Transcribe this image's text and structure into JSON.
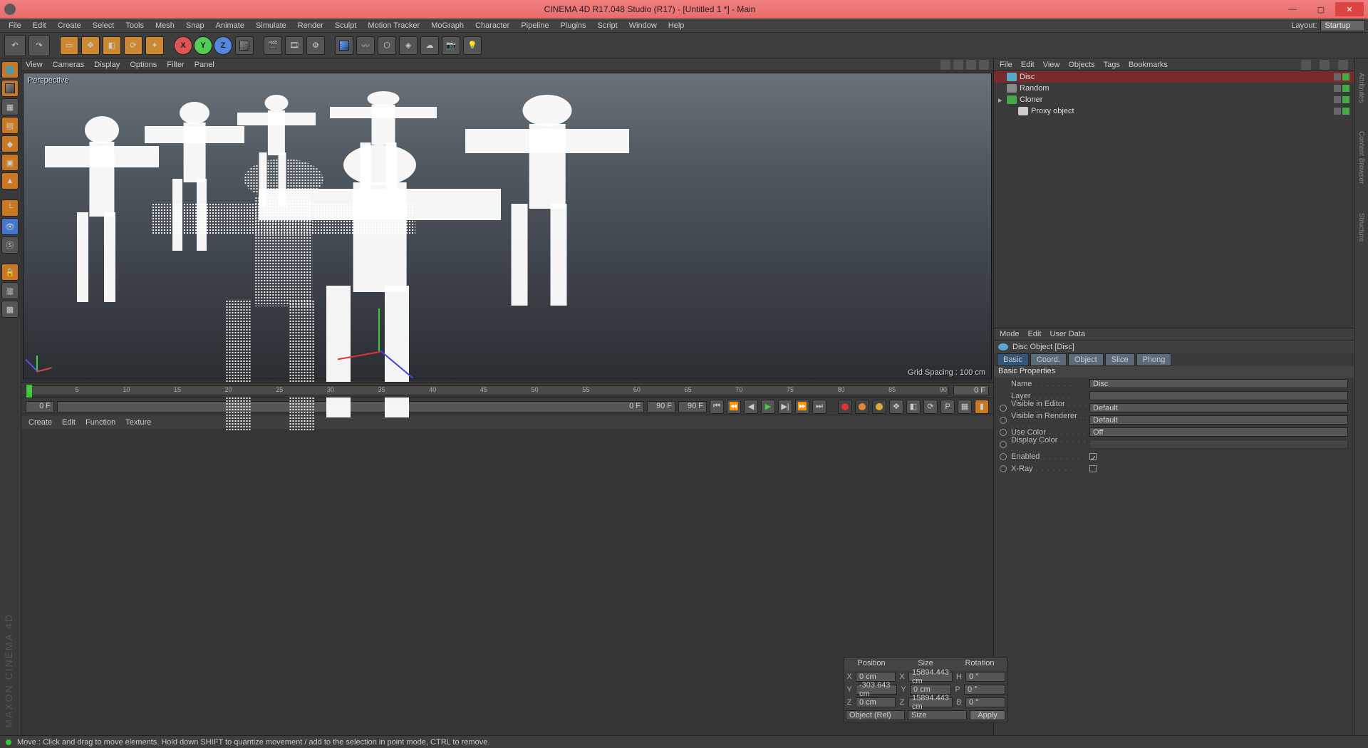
{
  "titlebar": {
    "text": "CINEMA 4D R17.048 Studio (R17) - [Untitled 1 *] - Main"
  },
  "menubar": {
    "items": [
      "File",
      "Edit",
      "Create",
      "Select",
      "Tools",
      "Mesh",
      "Snap",
      "Animate",
      "Simulate",
      "Render",
      "Sculpt",
      "Motion Tracker",
      "MoGraph",
      "Character",
      "Pipeline",
      "Plugins",
      "Script",
      "Window",
      "Help"
    ],
    "layout_label": "Layout:",
    "layout_value": "Startup"
  },
  "viewmenu": {
    "items": [
      "View",
      "Cameras",
      "Display",
      "Options",
      "Filter",
      "Panel"
    ]
  },
  "viewport": {
    "label": "Perspective",
    "gridspacing": "Grid Spacing : 100 cm"
  },
  "timeline": {
    "ticks": [
      "0",
      "5",
      "10",
      "15",
      "20",
      "25",
      "30",
      "35",
      "40",
      "45",
      "50",
      "55",
      "60",
      "65",
      "70",
      "75",
      "80",
      "85",
      "90"
    ],
    "frame_end": "0 F"
  },
  "playrow": {
    "start": "0 F",
    "current": "0 F",
    "range_end": "90 F",
    "end": "90 F"
  },
  "matbar": {
    "items": [
      "Create",
      "Edit",
      "Function",
      "Texture"
    ]
  },
  "coord": {
    "headers": [
      "Position",
      "Size",
      "Rotation"
    ],
    "rows": [
      {
        "axis": "X",
        "p": "0 cm",
        "s": "15894.443 cm",
        "r": "0 °",
        "slabel": "X",
        "rlabel": "H"
      },
      {
        "axis": "Y",
        "p": "-303.643 cm",
        "s": "0 cm",
        "r": "0 °",
        "slabel": "Y",
        "rlabel": "P"
      },
      {
        "axis": "Z",
        "p": "0 cm",
        "s": "15894.443 cm",
        "r": "0 °",
        "slabel": "Z",
        "rlabel": "B"
      }
    ],
    "mode": "Object (Rel)",
    "sizemode": "Size",
    "apply": "Apply"
  },
  "omgr": {
    "menu": [
      "File",
      "Edit",
      "View",
      "Objects",
      "Tags",
      "Bookmarks"
    ],
    "items": [
      {
        "name": "Disc",
        "sel": true,
        "indent": 0,
        "icon": "#5ac"
      },
      {
        "name": "Random",
        "sel": false,
        "indent": 0,
        "icon": "#888"
      },
      {
        "name": "Cloner",
        "sel": false,
        "indent": 0,
        "icon": "#4a4"
      },
      {
        "name": "Proxy object",
        "sel": false,
        "indent": 1,
        "icon": "#ccc"
      }
    ]
  },
  "attr": {
    "menu": [
      "Mode",
      "Edit",
      "User Data"
    ],
    "title": "Disc Object [Disc]",
    "tabs": [
      "Basic",
      "Coord.",
      "Object",
      "Slice",
      "Phong"
    ],
    "section": "Basic Properties",
    "props": [
      {
        "label": "Name",
        "value": "Disc",
        "type": "text"
      },
      {
        "label": "Layer",
        "value": "",
        "type": "text"
      },
      {
        "label": "Visible in Editor",
        "value": "Default",
        "type": "dd",
        "radio": true
      },
      {
        "label": "Visible in Renderer",
        "value": "Default",
        "type": "dd",
        "radio": true
      },
      {
        "label": "Use Color",
        "value": "Off",
        "type": "dd",
        "radio": true
      },
      {
        "label": "Display Color",
        "value": "",
        "type": "color",
        "radio": true,
        "disabled": true
      },
      {
        "label": "Enabled",
        "value": "✓",
        "type": "check",
        "radio": true
      },
      {
        "label": "X-Ray",
        "value": "",
        "type": "check",
        "radio": true
      }
    ]
  },
  "farright": {
    "tabs": [
      "Attributes",
      "Content Browser",
      "Structure"
    ]
  },
  "status": {
    "text": "Move : Click and drag to move elements. Hold down SHIFT to quantize movement / add to the selection in point mode, CTRL to remove."
  },
  "brand": "MAXON CINEMA 4D"
}
